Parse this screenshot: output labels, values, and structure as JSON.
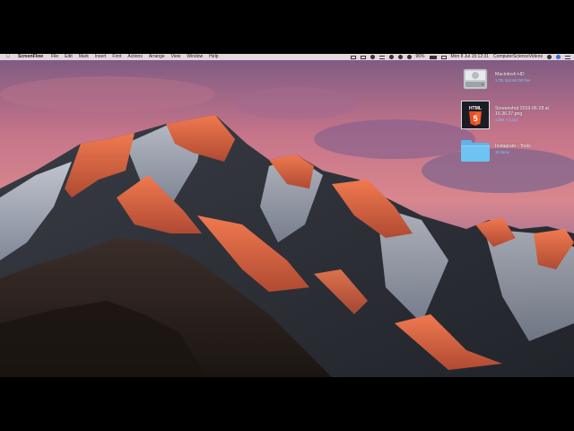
{
  "menubar": {
    "app_name": "ScreenFlow",
    "menus": [
      "File",
      "Edit",
      "Mark",
      "Insert",
      "Font",
      "Actions",
      "Arrange",
      "View",
      "Window",
      "Help"
    ],
    "battery": "96%",
    "clock": "Mon 8 Jul  15:12:31",
    "user": "ComputerScienceVideos"
  },
  "desktop": {
    "items": [
      {
        "name": "Macintosh HD",
        "info": "1 TB, 524.66 GB free",
        "icon": "hard-drive-icon"
      },
      {
        "name": "Screenshot 2019-06-28 at 16.36.27.png",
        "info": "1,094 × 1,112",
        "icon": "html5-screenshot-thumbnail",
        "thumb_text": "HTML",
        "thumb_badge": "5"
      },
      {
        "name": "Instagram - Tools",
        "info": "15 items",
        "icon": "folder-icon"
      }
    ]
  },
  "colors": {
    "folder_blue": "#6ec3f2",
    "html5_orange": "#e44d26",
    "info_blue": "#7ec8ff"
  }
}
